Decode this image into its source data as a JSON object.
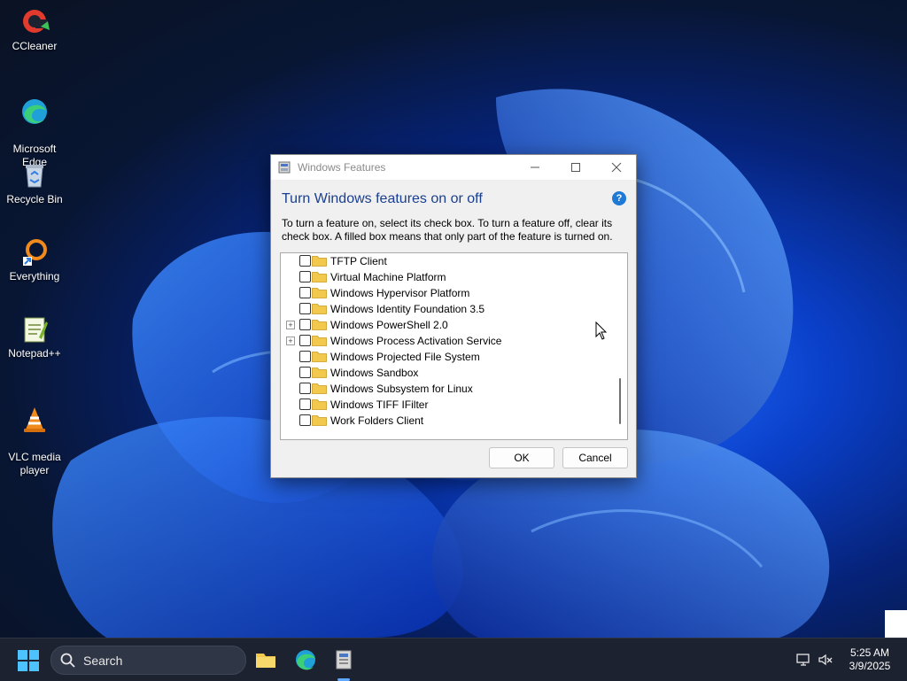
{
  "desktop": {
    "icons": [
      {
        "label": "CCleaner"
      },
      {
        "label": "Microsoft\nEdge"
      },
      {
        "label": "Recycle Bin"
      },
      {
        "label": "Everything"
      },
      {
        "label": "Notepad++"
      },
      {
        "label": "VLC media\nplayer"
      }
    ]
  },
  "dialog": {
    "window_title": "Windows Features",
    "heading": "Turn Windows features on or off",
    "help_label": "?",
    "description": "To turn a feature on, select its check box. To turn a feature off, clear its check box. A filled box means that only part of the feature is turned on.",
    "features": [
      {
        "label": "TFTP Client",
        "expandable": false,
        "checked": false
      },
      {
        "label": "Virtual Machine Platform",
        "expandable": false,
        "checked": false
      },
      {
        "label": "Windows Hypervisor Platform",
        "expandable": false,
        "checked": false
      },
      {
        "label": "Windows Identity Foundation 3.5",
        "expandable": false,
        "checked": false
      },
      {
        "label": "Windows PowerShell 2.0",
        "expandable": true,
        "checked": false
      },
      {
        "label": "Windows Process Activation Service",
        "expandable": true,
        "checked": false
      },
      {
        "label": "Windows Projected File System",
        "expandable": false,
        "checked": false
      },
      {
        "label": "Windows Sandbox",
        "expandable": false,
        "checked": false
      },
      {
        "label": "Windows Subsystem for Linux",
        "expandable": false,
        "checked": false
      },
      {
        "label": "Windows TIFF IFilter",
        "expandable": false,
        "checked": false
      },
      {
        "label": "Work Folders Client",
        "expandable": false,
        "checked": false
      }
    ],
    "ok_label": "OK",
    "cancel_label": "Cancel",
    "expander_glyph": "+"
  },
  "taskbar": {
    "search_placeholder": "Search",
    "clock_time": "5:25 AM",
    "clock_date": "3/9/2025"
  },
  "colors": {
    "accent": "#1e7ad4",
    "heading": "#1a3f8f",
    "folder": "#f2c94c",
    "taskbar": "#1c2230"
  }
}
